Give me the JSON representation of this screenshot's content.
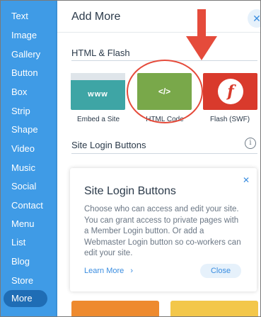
{
  "sidebar": {
    "items": [
      {
        "label": "Text"
      },
      {
        "label": "Image"
      },
      {
        "label": "Gallery"
      },
      {
        "label": "Button"
      },
      {
        "label": "Box"
      },
      {
        "label": "Strip"
      },
      {
        "label": "Shape"
      },
      {
        "label": "Video"
      },
      {
        "label": "Music"
      },
      {
        "label": "Social"
      },
      {
        "label": "Contact"
      },
      {
        "label": "Menu"
      },
      {
        "label": "List"
      },
      {
        "label": "Blog"
      },
      {
        "label": "Store"
      },
      {
        "label": "More"
      }
    ],
    "active_index": 15
  },
  "panel": {
    "title": "Add More",
    "close_symbol": "✕",
    "html_flash": {
      "heading": "HTML & Flash",
      "tiles": [
        {
          "label": "Embed a Site",
          "tile_text": "www",
          "icon": "browser-icon"
        },
        {
          "label": "HTML Code",
          "tile_text": "</>",
          "icon": "code-icon"
        },
        {
          "label": "Flash (SWF)",
          "tile_text": "f",
          "icon": "flash-icon"
        }
      ]
    },
    "site_login": {
      "heading": "Site Login Buttons",
      "info_symbol": "i"
    },
    "info_card": {
      "close_symbol": "✕",
      "title": "Site Login Buttons",
      "body": "Choose who can access and edit your site. You can grant access to private pages with a Member Login button. Or add a Webmaster Login button so co-workers can edit your site.",
      "learn_more": "Learn More",
      "learn_more_chevron": "›",
      "close_label": "Close"
    }
  },
  "colors": {
    "sidebar_bg": "#3f9be6",
    "sidebar_active": "#1f6db5",
    "accent": "#3a8de0",
    "annotation_red": "#e54b3b",
    "embed_tile": "#3ea5a5",
    "html_tile": "#79a84a",
    "flash_tile": "#d93a2c"
  }
}
